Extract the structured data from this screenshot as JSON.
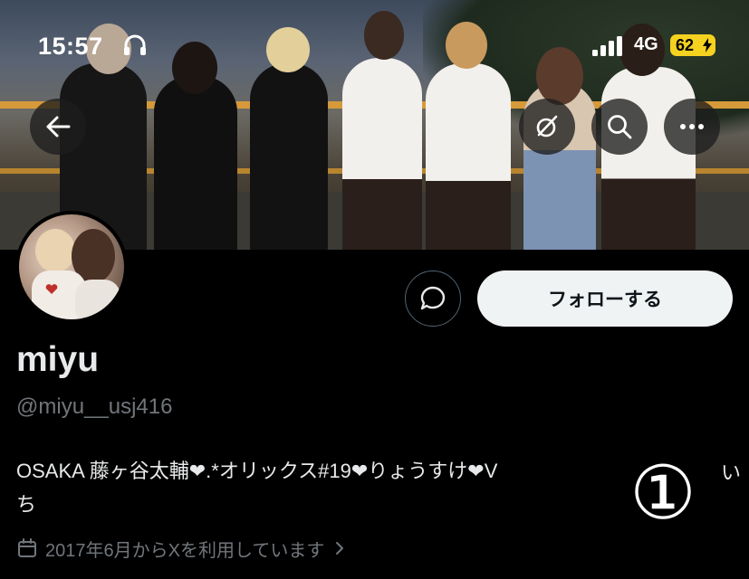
{
  "status_bar": {
    "time": "15:57",
    "network": "4G",
    "battery": "62",
    "headphone_icon": "headphones-icon",
    "signal_icon": "cellular-signal-icon",
    "charging_icon": "charging-bolt-icon",
    "battery_color": "#f5d21f"
  },
  "header": {
    "back_icon": "back-arrow-icon",
    "grok_icon": "grok-icon",
    "search_icon": "search-icon",
    "more_icon": "more-icon"
  },
  "profile": {
    "name": "miyu",
    "handle": "@miyu__usj416",
    "bio_line1": "OSAKA 藤ヶ谷太輔❤︎.*オリックス#19❤︎りょうすけ❤︎V",
    "bio_line2": "ち",
    "bio_overlay_mark": "①",
    "bio_trailing": "い",
    "joined": "2017年6月からXを利用しています",
    "follow_label": "フォローする",
    "message_icon": "message-bubble-icon",
    "calendar_icon": "calendar-icon",
    "chevron_icon": "chevron-right-icon"
  },
  "colors": {
    "background": "#000000",
    "primary_text": "#e7e9ea",
    "secondary_text": "#71767b",
    "follow_bg": "#eff3f4"
  }
}
